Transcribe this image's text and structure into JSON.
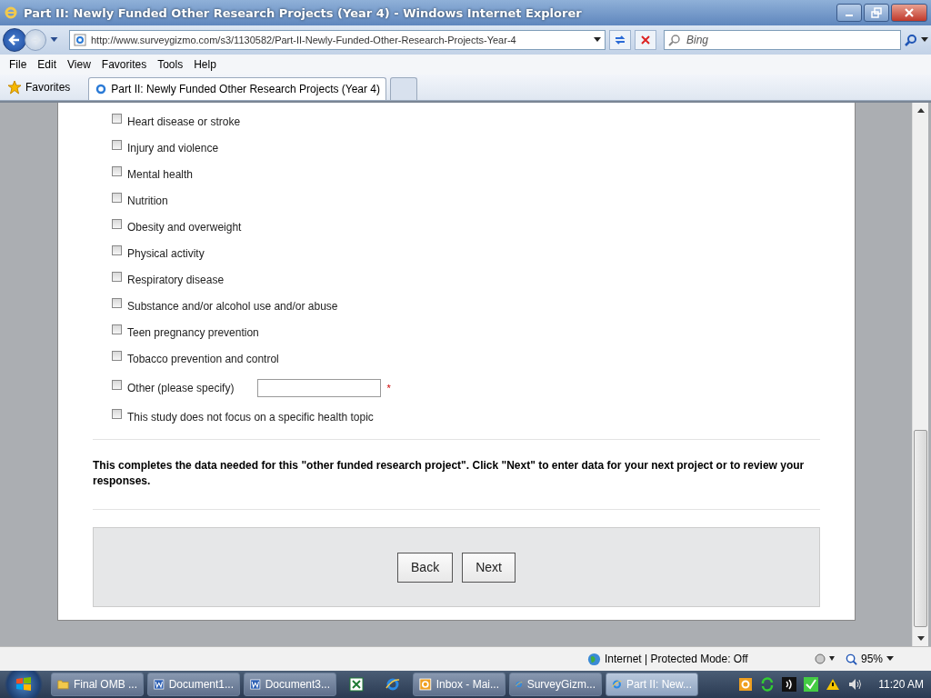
{
  "window": {
    "title": "Part II: Newly Funded Other Research Projects (Year 4) - Windows Internet Explorer"
  },
  "address_bar": {
    "url": "http://www.surveygizmo.com/s3/1130582/Part-II-Newly-Funded-Other-Research-Projects-Year-4",
    "search_placeholder": "Bing"
  },
  "menu": [
    "File",
    "Edit",
    "View",
    "Favorites",
    "Tools",
    "Help"
  ],
  "favorites_label": "Favorites",
  "tabs": [
    {
      "label": "Part II: Newly Funded Other Research Projects (Year 4)",
      "selected": true
    }
  ],
  "options": [
    {
      "kind": "plain",
      "label": "Heart disease or stroke",
      "checked": false
    },
    {
      "kind": "plain",
      "label": "Injury and violence",
      "checked": false
    },
    {
      "kind": "plain",
      "label": "Mental health",
      "checked": false
    },
    {
      "kind": "plain",
      "label": "Nutrition",
      "checked": false
    },
    {
      "kind": "plain",
      "label": "Obesity and overweight",
      "checked": false
    },
    {
      "kind": "plain",
      "label": "Physical activity",
      "checked": false
    },
    {
      "kind": "plain",
      "label": "Respiratory disease",
      "checked": false
    },
    {
      "kind": "plain",
      "label": "Substance and/or alcohol use and/or abuse",
      "checked": false
    },
    {
      "kind": "plain",
      "label": "Teen pregnancy prevention",
      "checked": false
    },
    {
      "kind": "plain",
      "label": "Tobacco prevention and control",
      "checked": false
    },
    {
      "kind": "specify",
      "label": "Other (please specify)",
      "checked": false,
      "required_mark": "*"
    },
    {
      "kind": "plain",
      "label": "This study does not focus on a specific health topic",
      "checked": false
    }
  ],
  "closing_text": "This completes the data needed for this \"other funded research project\". Click \"Next\" to enter data for your next project or to review your responses.",
  "buttons": [
    "Back",
    "Next"
  ],
  "status_bar": {
    "zone": "Internet | Protected Mode: Off",
    "zoom": "95%"
  },
  "taskbar": {
    "items": [
      {
        "kind": "folder",
        "label": "Final OMB ...",
        "selected": false
      },
      {
        "kind": "word",
        "label": "Document1...",
        "selected": false
      },
      {
        "kind": "word",
        "label": "Document3...",
        "selected": false
      },
      {
        "kind": "excel",
        "selected": false
      },
      {
        "kind": "ie",
        "selected": false
      },
      {
        "kind": "outlook",
        "label": "Inbox - Mai...",
        "selected": false
      },
      {
        "kind": "ie",
        "label": "SurveyGizm...",
        "selected": false
      },
      {
        "kind": "ie",
        "label": "Part II: New...",
        "selected": true
      }
    ],
    "clock": "11:20 AM"
  }
}
